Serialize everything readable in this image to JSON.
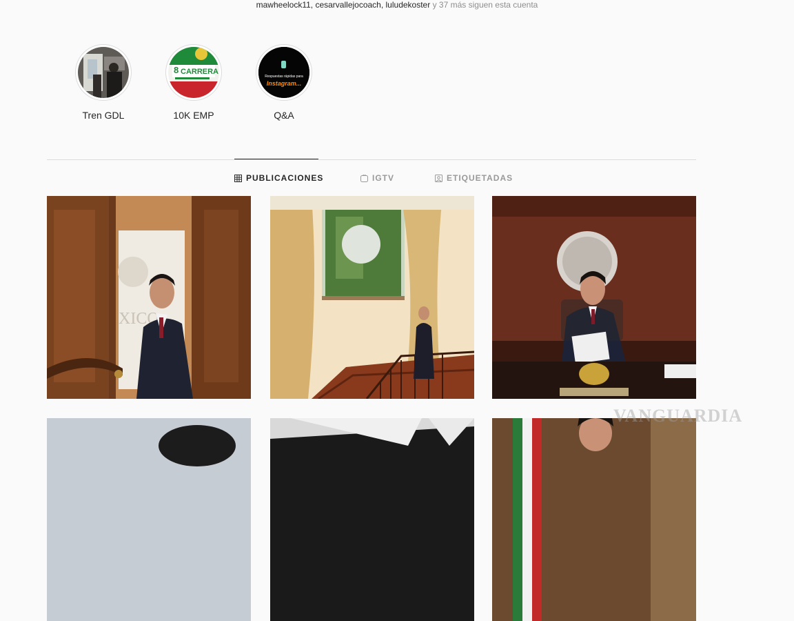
{
  "followed_by": {
    "names": "mawheelock11, cesarvallejocoach, luludekoster",
    "suffix": "y 37 más siguen esta cuenta"
  },
  "highlights": [
    {
      "label": "Tren GDL",
      "icon": "train-photo"
    },
    {
      "label": "10K EMP",
      "icon": "race-poster"
    },
    {
      "label": "Q&A",
      "icon": "qa-poster",
      "cover_line1": "Respuestas rápidas para",
      "cover_line2": "Instagram..."
    }
  ],
  "race_cover_number": "8",
  "race_cover_text": "CARRERA",
  "tabs": [
    {
      "label": "PUBLICACIONES",
      "icon": "grid-icon",
      "active": true
    },
    {
      "label": "IGTV",
      "icon": "igtv-icon",
      "active": false
    },
    {
      "label": "ETIQUETADAS",
      "icon": "tagged-icon",
      "active": false
    }
  ],
  "post_texts": {
    "door_sign": "XICO"
  },
  "watermark": "VANGUARDIA",
  "colors": {
    "accent": "#262626",
    "muted": "#8e8e8e",
    "border": "#dbdbdb",
    "qa_orange": "#ff8c00"
  }
}
